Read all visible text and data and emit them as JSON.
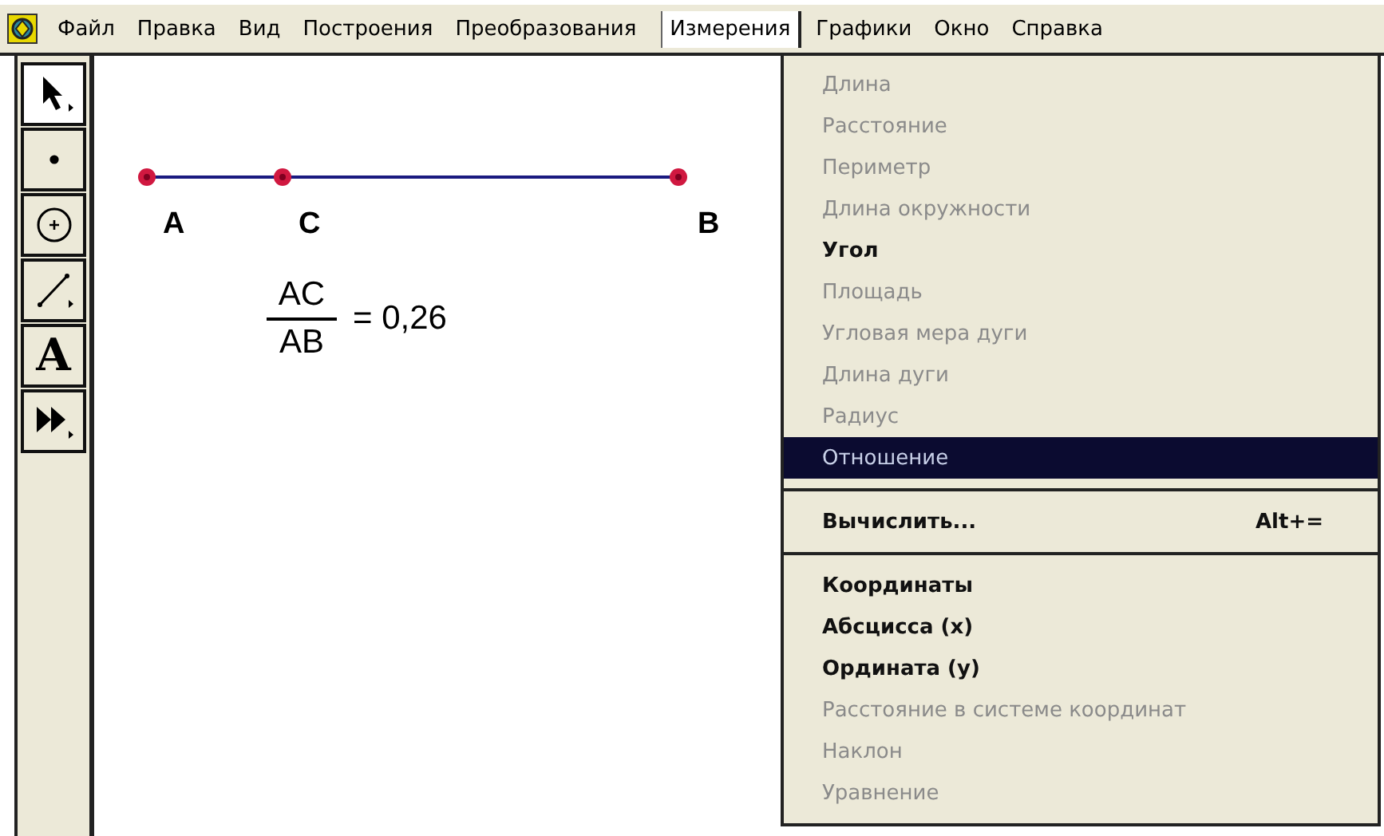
{
  "menu_bar": [
    {
      "label": "Файл",
      "selected": false
    },
    {
      "label": "Правка",
      "selected": false
    },
    {
      "label": "Вид",
      "selected": false
    },
    {
      "label": "Построения",
      "selected": false
    },
    {
      "label": "Преобразования",
      "selected": false
    },
    {
      "label": "Измерения",
      "selected": true
    },
    {
      "label": "Графики",
      "selected": false
    },
    {
      "label": "Окно",
      "selected": false
    },
    {
      "label": "Справка",
      "selected": false
    }
  ],
  "toolbox": [
    {
      "kind": "arrow",
      "selected": true
    },
    {
      "kind": "point",
      "selected": false
    },
    {
      "kind": "compass",
      "selected": false
    },
    {
      "kind": "segment",
      "selected": false
    },
    {
      "kind": "text",
      "glyph": "A",
      "selected": false
    },
    {
      "kind": "custom",
      "selected": false
    }
  ],
  "canvas": {
    "points": [
      {
        "label": "A"
      },
      {
        "label": "C"
      },
      {
        "label": "B"
      }
    ],
    "measurement": {
      "numerator": "AC",
      "denominator": "AB",
      "value": "= 0,26"
    }
  },
  "menu": {
    "items": [
      {
        "kind": "item",
        "label": "Длина",
        "disabled": true,
        "selected": false
      },
      {
        "kind": "item",
        "label": "Расстояние",
        "disabled": true,
        "selected": false
      },
      {
        "kind": "item",
        "label": "Периметр",
        "disabled": true,
        "selected": false
      },
      {
        "kind": "item",
        "label": "Длина окружности",
        "disabled": true,
        "selected": false
      },
      {
        "kind": "item",
        "label": "Угол",
        "disabled": false,
        "selected": false
      },
      {
        "kind": "item",
        "label": "Площадь",
        "disabled": true,
        "selected": false
      },
      {
        "kind": "item",
        "label": "Угловая мера дуги",
        "disabled": true,
        "selected": false
      },
      {
        "kind": "item",
        "label": "Длина дуги",
        "disabled": true,
        "selected": false
      },
      {
        "kind": "item",
        "label": "Радиус",
        "disabled": true,
        "selected": false
      },
      {
        "kind": "item",
        "label": "Отношение",
        "disabled": true,
        "selected": true
      },
      {
        "kind": "separator"
      },
      {
        "kind": "item",
        "label": "Вычислить...",
        "shortcut": "Alt+=",
        "disabled": false,
        "selected": false
      },
      {
        "kind": "separator"
      },
      {
        "kind": "item",
        "label": "Координаты",
        "disabled": false,
        "selected": false
      },
      {
        "kind": "item",
        "label": "Абсцисса (x)",
        "disabled": false,
        "selected": false
      },
      {
        "kind": "item",
        "label": "Ордината (y)",
        "disabled": false,
        "selected": false
      },
      {
        "kind": "item",
        "label": "Расстояние в системе координат",
        "disabled": true,
        "selected": false
      },
      {
        "kind": "item",
        "label": "Наклон",
        "disabled": true,
        "selected": false
      },
      {
        "kind": "item",
        "label": "Уравнение",
        "disabled": true,
        "selected": false
      }
    ]
  }
}
